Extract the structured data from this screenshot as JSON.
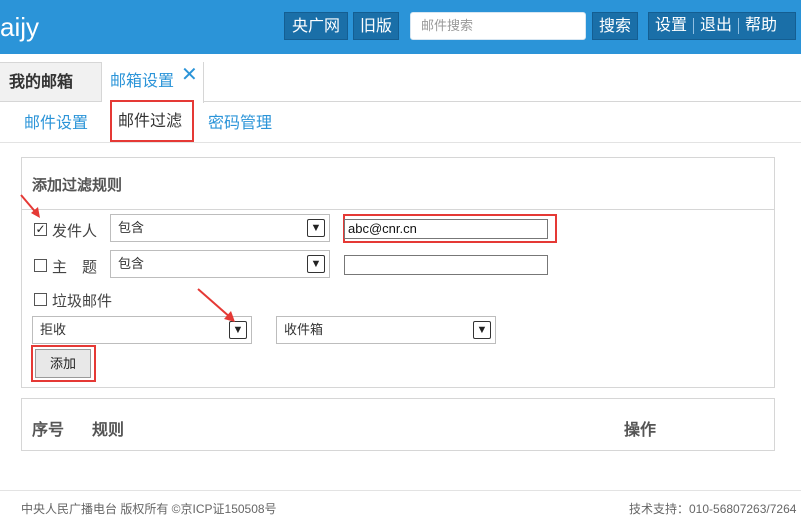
{
  "header": {
    "logo_text": "aijy",
    "cctv_label": "央广网",
    "old_version_label": "旧版",
    "search_placeholder": "邮件搜索",
    "search_label": "搜索",
    "settings_label": "设置",
    "logout_label": "退出",
    "help_label": "帮助"
  },
  "tabs": {
    "my_mail": "我的邮箱",
    "mailbox_settings": "邮箱设置"
  },
  "subtabs": {
    "mail_settings": "邮件设置",
    "mail_filter": "邮件过滤",
    "password": "密码管理"
  },
  "filter": {
    "title": "添加过滤规则",
    "sender": {
      "label": "发件人",
      "checked": true,
      "condition": "包含",
      "value": "abc@cnr.cn"
    },
    "subject": {
      "label": "主　题",
      "checked": false,
      "condition": "包含",
      "value": ""
    },
    "spam": {
      "label": "垃圾邮件",
      "checked": false
    },
    "action": "拒收",
    "folder": "收件箱",
    "add_button": "添加"
  },
  "rules_table": {
    "columns": [
      "序号",
      "规则",
      "操作"
    ]
  },
  "footer": {
    "copyright": "中央人民广播电台 版权所有 ©京ICP证150508号",
    "support": "技术支持：010-56807263/7264"
  },
  "colors": {
    "accent": "#2b94d8",
    "highlight": "#e53935"
  }
}
